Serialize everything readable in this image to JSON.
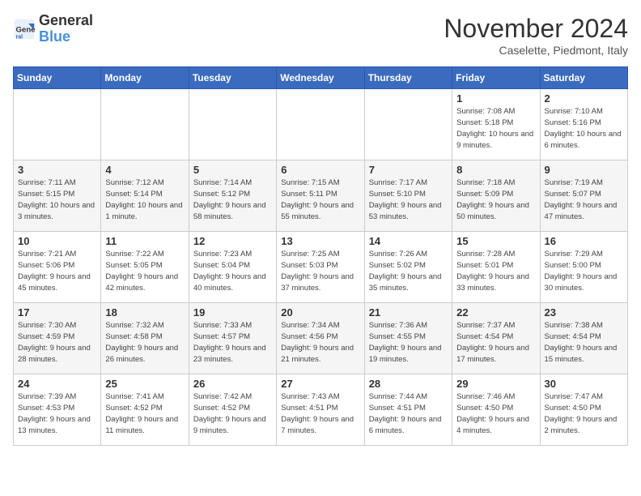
{
  "logo": {
    "text_general": "General",
    "text_blue": "Blue"
  },
  "title": "November 2024",
  "subtitle": "Caselette, Piedmont, Italy",
  "days_of_week": [
    "Sunday",
    "Monday",
    "Tuesday",
    "Wednesday",
    "Thursday",
    "Friday",
    "Saturday"
  ],
  "weeks": [
    [
      {
        "day": "",
        "info": ""
      },
      {
        "day": "",
        "info": ""
      },
      {
        "day": "",
        "info": ""
      },
      {
        "day": "",
        "info": ""
      },
      {
        "day": "",
        "info": ""
      },
      {
        "day": "1",
        "info": "Sunrise: 7:08 AM\nSunset: 5:18 PM\nDaylight: 10 hours and 9 minutes."
      },
      {
        "day": "2",
        "info": "Sunrise: 7:10 AM\nSunset: 5:16 PM\nDaylight: 10 hours and 6 minutes."
      }
    ],
    [
      {
        "day": "3",
        "info": "Sunrise: 7:11 AM\nSunset: 5:15 PM\nDaylight: 10 hours and 3 minutes."
      },
      {
        "day": "4",
        "info": "Sunrise: 7:12 AM\nSunset: 5:14 PM\nDaylight: 10 hours and 1 minute."
      },
      {
        "day": "5",
        "info": "Sunrise: 7:14 AM\nSunset: 5:12 PM\nDaylight: 9 hours and 58 minutes."
      },
      {
        "day": "6",
        "info": "Sunrise: 7:15 AM\nSunset: 5:11 PM\nDaylight: 9 hours and 55 minutes."
      },
      {
        "day": "7",
        "info": "Sunrise: 7:17 AM\nSunset: 5:10 PM\nDaylight: 9 hours and 53 minutes."
      },
      {
        "day": "8",
        "info": "Sunrise: 7:18 AM\nSunset: 5:09 PM\nDaylight: 9 hours and 50 minutes."
      },
      {
        "day": "9",
        "info": "Sunrise: 7:19 AM\nSunset: 5:07 PM\nDaylight: 9 hours and 47 minutes."
      }
    ],
    [
      {
        "day": "10",
        "info": "Sunrise: 7:21 AM\nSunset: 5:06 PM\nDaylight: 9 hours and 45 minutes."
      },
      {
        "day": "11",
        "info": "Sunrise: 7:22 AM\nSunset: 5:05 PM\nDaylight: 9 hours and 42 minutes."
      },
      {
        "day": "12",
        "info": "Sunrise: 7:23 AM\nSunset: 5:04 PM\nDaylight: 9 hours and 40 minutes."
      },
      {
        "day": "13",
        "info": "Sunrise: 7:25 AM\nSunset: 5:03 PM\nDaylight: 9 hours and 37 minutes."
      },
      {
        "day": "14",
        "info": "Sunrise: 7:26 AM\nSunset: 5:02 PM\nDaylight: 9 hours and 35 minutes."
      },
      {
        "day": "15",
        "info": "Sunrise: 7:28 AM\nSunset: 5:01 PM\nDaylight: 9 hours and 33 minutes."
      },
      {
        "day": "16",
        "info": "Sunrise: 7:29 AM\nSunset: 5:00 PM\nDaylight: 9 hours and 30 minutes."
      }
    ],
    [
      {
        "day": "17",
        "info": "Sunrise: 7:30 AM\nSunset: 4:59 PM\nDaylight: 9 hours and 28 minutes."
      },
      {
        "day": "18",
        "info": "Sunrise: 7:32 AM\nSunset: 4:58 PM\nDaylight: 9 hours and 26 minutes."
      },
      {
        "day": "19",
        "info": "Sunrise: 7:33 AM\nSunset: 4:57 PM\nDaylight: 9 hours and 23 minutes."
      },
      {
        "day": "20",
        "info": "Sunrise: 7:34 AM\nSunset: 4:56 PM\nDaylight: 9 hours and 21 minutes."
      },
      {
        "day": "21",
        "info": "Sunrise: 7:36 AM\nSunset: 4:55 PM\nDaylight: 9 hours and 19 minutes."
      },
      {
        "day": "22",
        "info": "Sunrise: 7:37 AM\nSunset: 4:54 PM\nDaylight: 9 hours and 17 minutes."
      },
      {
        "day": "23",
        "info": "Sunrise: 7:38 AM\nSunset: 4:54 PM\nDaylight: 9 hours and 15 minutes."
      }
    ],
    [
      {
        "day": "24",
        "info": "Sunrise: 7:39 AM\nSunset: 4:53 PM\nDaylight: 9 hours and 13 minutes."
      },
      {
        "day": "25",
        "info": "Sunrise: 7:41 AM\nSunset: 4:52 PM\nDaylight: 9 hours and 11 minutes."
      },
      {
        "day": "26",
        "info": "Sunrise: 7:42 AM\nSunset: 4:52 PM\nDaylight: 9 hours and 9 minutes."
      },
      {
        "day": "27",
        "info": "Sunrise: 7:43 AM\nSunset: 4:51 PM\nDaylight: 9 hours and 7 minutes."
      },
      {
        "day": "28",
        "info": "Sunrise: 7:44 AM\nSunset: 4:51 PM\nDaylight: 9 hours and 6 minutes."
      },
      {
        "day": "29",
        "info": "Sunrise: 7:46 AM\nSunset: 4:50 PM\nDaylight: 9 hours and 4 minutes."
      },
      {
        "day": "30",
        "info": "Sunrise: 7:47 AM\nSunset: 4:50 PM\nDaylight: 9 hours and 2 minutes."
      }
    ]
  ]
}
